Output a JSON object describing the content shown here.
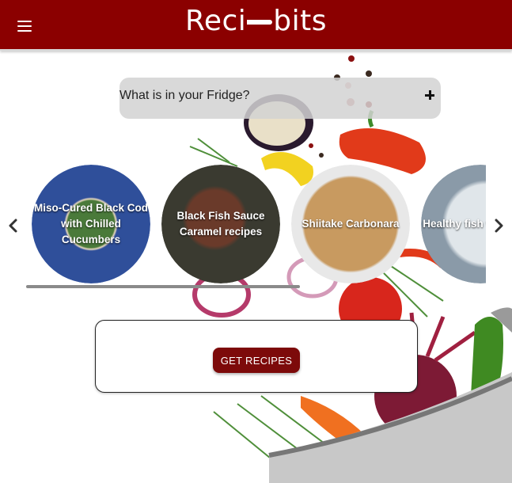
{
  "header": {
    "brand_left": "Reci",
    "brand_right": "bits",
    "menu_icon": "menu-icon"
  },
  "fridge": {
    "label": "What is in your Fridge?",
    "add_icon": "plus-icon"
  },
  "carousel": {
    "prev_icon": "chevron-left-icon",
    "next_icon": "chevron-right-icon",
    "recipes": [
      {
        "title": "Miso-Cured Black Cod with Chilled Cucumbers"
      },
      {
        "title": "Black Fish Sauce Caramel recipes"
      },
      {
        "title": "Shiitake Carbonara"
      },
      {
        "title": "Healthy fish with tartar"
      }
    ]
  },
  "actions": {
    "get_recipes_label": "GET RECIPES"
  },
  "colors": {
    "brand": "#8b0000",
    "button": "#7d0a0a"
  }
}
